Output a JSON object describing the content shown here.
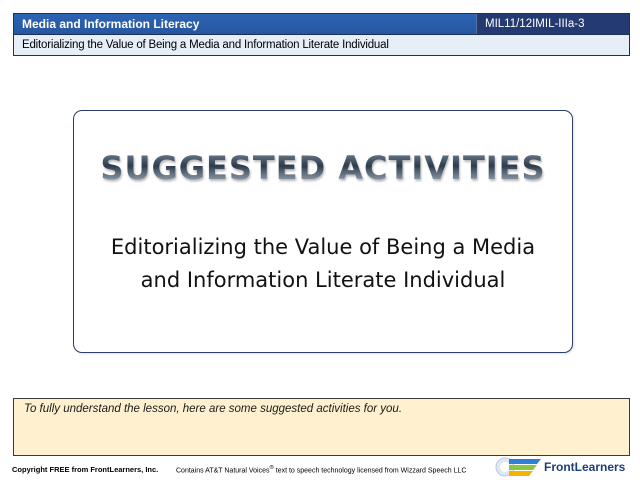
{
  "header": {
    "title": "Media and Information Literacy",
    "code": "MIL11/12IMIL-IIIa-3",
    "subtitle": "Editorializing the Value of Being a Media and Information Literate Individual"
  },
  "card": {
    "heading": "SUGGESTED ACTIVITIES",
    "line1": "Editorializing the Value of Being a Media",
    "line2": "and Information Literate Individual"
  },
  "note": {
    "text": "To fully understand the lesson, here are some suggested activities for you."
  },
  "footer": {
    "copyright": "Copyright FREE from FrontLearners, Inc.",
    "voices_prefix": "Contains AT&T Natural Voices",
    "voices_mark": "®",
    "voices_suffix": " text to speech technology licensed from Wizzard Speech LLC",
    "brand": "FrontLearners",
    "logo_icon": "frontlearners-logo-icon"
  },
  "colors": {
    "header_title_bg": "#2c64b4",
    "header_code_bg": "#243a72",
    "header_subtitle_bg": "#e6eef8",
    "note_bg": "#fff1cf",
    "brand_text": "#1f3f7a"
  }
}
